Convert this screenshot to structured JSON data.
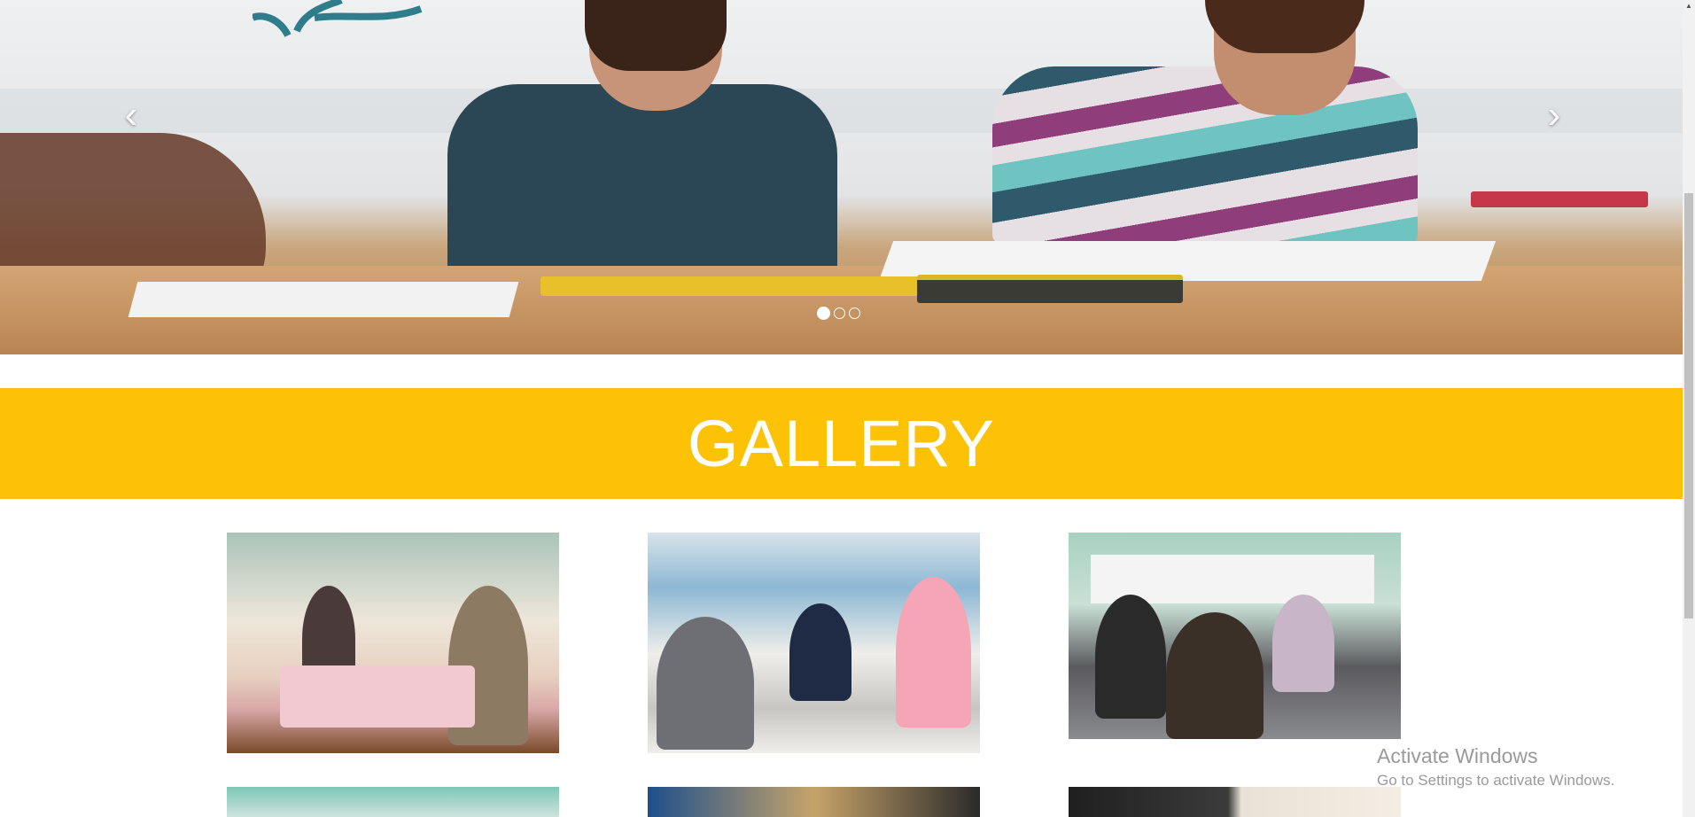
{
  "carousel": {
    "prev_icon": "chevron-left-icon",
    "next_icon": "chevron-right-icon",
    "prev_glyph": "‹",
    "next_glyph": "›",
    "slide_count": 3,
    "active_slide": 1
  },
  "gallery": {
    "title": "GALLERY",
    "accent_color": "#fdc106"
  },
  "watermark": {
    "title": "Activate Windows",
    "subtitle": "Go to Settings to activate Windows."
  }
}
